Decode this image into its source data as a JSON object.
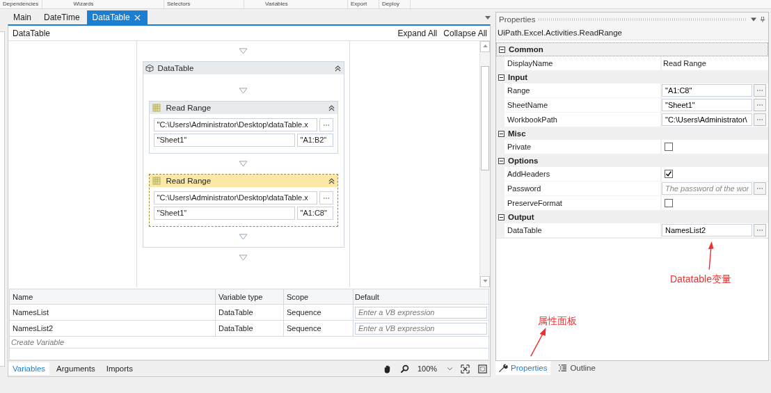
{
  "ribbon_groups": [
    "Dependencies",
    "Wizards",
    "Selectors",
    "Variables",
    "Export",
    "Deploy"
  ],
  "tabs": [
    {
      "label": "Main",
      "selected": false,
      "closable": false
    },
    {
      "label": "DateTime",
      "selected": false,
      "closable": false
    },
    {
      "label": "DataTable",
      "selected": true,
      "closable": true
    }
  ],
  "breadcrumb": "DataTable",
  "expand_all": "Expand All",
  "collapse_all": "Collapse All",
  "sequence": {
    "title": "DataTable",
    "activities": [
      {
        "title": "Read Range",
        "selected": false,
        "path": "\"C:\\Users\\Administrator\\Desktop\\dataTable.x",
        "sheet": "\"Sheet1\"",
        "range": "\"A1:B2\""
      },
      {
        "title": "Read Range",
        "selected": true,
        "path": "\"C:\\Users\\Administrator\\Desktop\\dataTable.x",
        "sheet": "\"Sheet1\"",
        "range": "\"A1:C8\""
      }
    ]
  },
  "variables": {
    "columns": [
      "Name",
      "Variable type",
      "Scope",
      "Default"
    ],
    "rows": [
      {
        "name": "NamesList",
        "type": "DataTable",
        "scope": "Sequence",
        "placeholder": "Enter a VB expression"
      },
      {
        "name": "NamesList2",
        "type": "DataTable",
        "scope": "Sequence",
        "placeholder": "Enter a VB expression"
      }
    ],
    "create_placeholder": "Create Variable"
  },
  "bottom_tabs": [
    {
      "label": "Variables",
      "selected": true
    },
    {
      "label": "Arguments",
      "selected": false
    },
    {
      "label": "Imports",
      "selected": false
    }
  ],
  "zoom": "100%",
  "properties": {
    "title": "Properties",
    "type_name": "UiPath.Excel.Activities.ReadRange",
    "categories": [
      {
        "name": "Common",
        "expanded": true,
        "rows": [
          {
            "label": "DisplayName",
            "kind": "text",
            "value": "Read Range"
          }
        ]
      },
      {
        "name": "Input",
        "expanded": true,
        "rows": [
          {
            "label": "Range",
            "kind": "field",
            "value": "\"A1:C8\""
          },
          {
            "label": "SheetName",
            "kind": "field",
            "value": "\"Sheet1\""
          },
          {
            "label": "WorkbookPath",
            "kind": "field",
            "value": "\"C:\\Users\\Administrator\\"
          }
        ]
      },
      {
        "name": "Misc",
        "expanded": true,
        "rows": [
          {
            "label": "Private",
            "kind": "checkbox",
            "checked": false
          }
        ]
      },
      {
        "name": "Options",
        "expanded": true,
        "rows": [
          {
            "label": "AddHeaders",
            "kind": "checkbox",
            "checked": true
          },
          {
            "label": "Password",
            "kind": "field",
            "placeholder": "The password of the wor"
          },
          {
            "label": "PreserveFormat",
            "kind": "checkbox",
            "checked": false
          }
        ]
      },
      {
        "name": "Output",
        "expanded": true,
        "rows": [
          {
            "label": "DataTable",
            "kind": "field",
            "value": "NamesList2"
          }
        ]
      }
    ]
  },
  "properties_tabs": [
    {
      "label": "Properties",
      "selected": true
    },
    {
      "label": "Outline",
      "selected": false
    }
  ],
  "annotations": [
    "Datatable变量",
    "属性面板"
  ]
}
